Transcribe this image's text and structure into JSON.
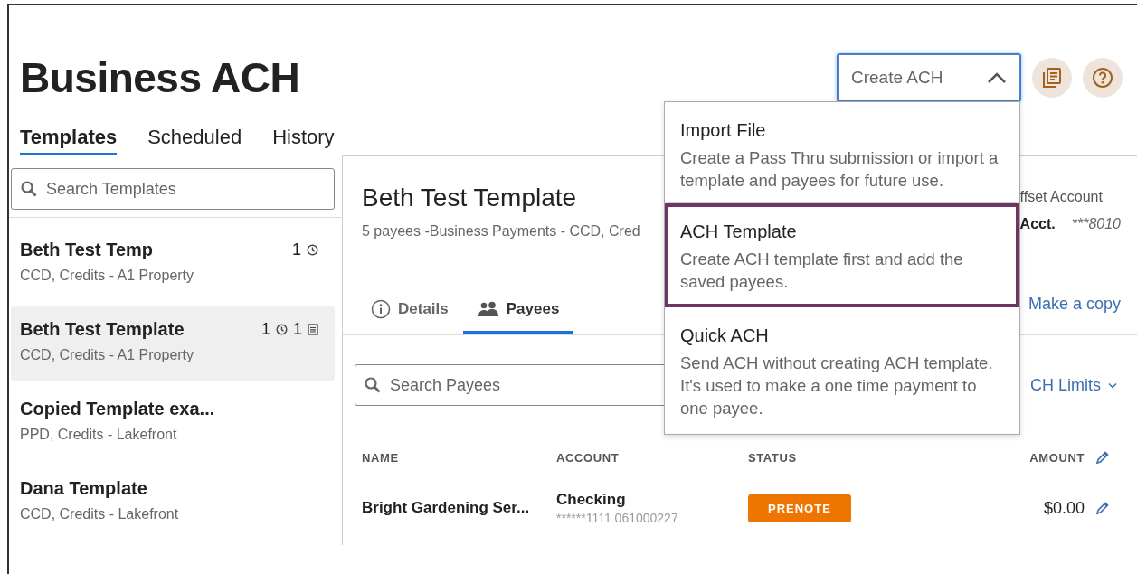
{
  "page_title": "Business ACH",
  "create_menu": {
    "label": "Create ACH",
    "expanded": true,
    "items": [
      {
        "title": "Import File",
        "description": "Create a Pass Thru submission or import a template and payees for future use.",
        "selected": false
      },
      {
        "title": "ACH Template",
        "description": "Create ACH template first and add the saved payees.",
        "selected": true
      },
      {
        "title": "Quick ACH",
        "description": "Send ACH without creating ACH template. It's used to make a one time payment to one payee.",
        "selected": false
      }
    ]
  },
  "tabs": [
    {
      "label": "Templates",
      "selected": true
    },
    {
      "label": "Scheduled",
      "selected": false
    },
    {
      "label": "History",
      "selected": false
    }
  ],
  "template_search": {
    "placeholder": "Search Templates"
  },
  "templates": [
    {
      "name": "Beth Test Temp",
      "details": "CCD, Credits - A1 Property",
      "selected": false,
      "counts": [
        {
          "value": "1",
          "kind": "scheduled"
        }
      ]
    },
    {
      "name": "Beth Test Template",
      "details": "CCD, Credits - A1 Property",
      "selected": true,
      "counts": [
        {
          "value": "1",
          "kind": "scheduled"
        },
        {
          "value": "1",
          "kind": "list"
        }
      ]
    },
    {
      "name": "Copied Template exa...",
      "details": "PPD, Credits - Lakefront",
      "selected": false
    },
    {
      "name": "Dana Template",
      "details": "CCD, Credits - Lakefront",
      "selected": false
    }
  ],
  "detail": {
    "title": "Beth Test Template",
    "subtitle": "5 payees -Business Payments - CCD, Cred",
    "offset_label": "ffset Account",
    "acct_label": "Acct.",
    "acct_number": "***8010",
    "copy_link": "Make a copy",
    "tabs": [
      {
        "label": "Details",
        "kind": "info",
        "selected": false
      },
      {
        "label": "Payees",
        "kind": "people",
        "selected": true
      }
    ],
    "payee_search": {
      "placeholder": "Search Payees"
    },
    "limits_link": "CH Limits",
    "columns": [
      "NAME",
      "ACCOUNT",
      "STATUS",
      "AMOUNT"
    ],
    "rows": [
      {
        "name": "Bright Gardening Ser...",
        "account_type": "Checking",
        "account_number": "******1111 061000227",
        "status": "PRENOTE",
        "amount": "$0.00"
      }
    ]
  }
}
